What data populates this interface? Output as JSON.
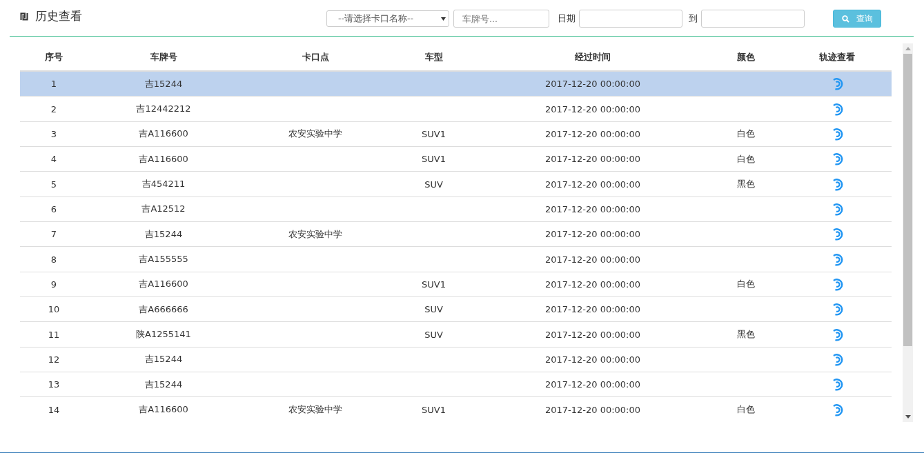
{
  "header": {
    "title": "历史查看"
  },
  "filters": {
    "checkpoint_select": {
      "value": "--请选择卡口名称--"
    },
    "plate_field": {
      "placeholder": "车牌号..."
    },
    "date_label": "日期",
    "to_label": "到",
    "query_button": "查询"
  },
  "table": {
    "columns": [
      "序号",
      "车牌号",
      "卡口点",
      "车型",
      "经过时间",
      "颜色",
      "轨迹查看"
    ],
    "rows": [
      {
        "no": "1",
        "plate": "吉15244",
        "time": "2017-12-20 00:00:00",
        "selected": true
      },
      {
        "no": "2",
        "plate": "吉12442212",
        "time": "2017-12-20 00:00:00",
        "selected": false
      },
      {
        "no": "3",
        "plate": "吉A116600",
        "checkpoint": "农安实验中学",
        "type": "SUV1",
        "time": "2017-12-20 00:00:00",
        "body_color": "白色",
        "selected": false
      },
      {
        "no": "4",
        "plate": "吉A116600",
        "type": "SUV1",
        "time": "2017-12-20 00:00:00",
        "body_color": "白色",
        "selected": false
      },
      {
        "no": "5",
        "plate": "吉454211",
        "type": "SUV",
        "time": "2017-12-20 00:00:00",
        "body_color": "黑色",
        "selected": false
      },
      {
        "no": "6",
        "plate": "吉A12512",
        "time": "2017-12-20 00:00:00",
        "selected": false
      },
      {
        "no": "7",
        "plate": "吉15244",
        "checkpoint": "农安实验中学",
        "time": "2017-12-20 00:00:00",
        "selected": false
      },
      {
        "no": "8",
        "plate": "吉A155555",
        "time": "2017-12-20 00:00:00",
        "selected": false
      },
      {
        "no": "9",
        "plate": "吉A116600",
        "type": "SUV1",
        "time": "2017-12-20 00:00:00",
        "body_color": "白色",
        "selected": false
      },
      {
        "no": "10",
        "plate": "吉A666666",
        "type": "SUV",
        "time": "2017-12-20 00:00:00",
        "selected": false
      },
      {
        "no": "11",
        "plate": "陕A1255141",
        "type": "SUV",
        "time": "2017-12-20 00:00:00",
        "body_color": "黑色",
        "selected": false
      },
      {
        "no": "12",
        "plate": "吉15244",
        "time": "2017-12-20 00:00:00",
        "selected": false
      },
      {
        "no": "13",
        "plate": "吉15244",
        "time": "2017-12-20 00:00:00",
        "selected": false
      },
      {
        "no": "14",
        "plate": "吉A116600",
        "checkpoint": "农安实验中学",
        "type": "SUV1",
        "time": "2017-12-20 00:00:00",
        "body_color": "白色",
        "selected": false
      }
    ]
  }
}
